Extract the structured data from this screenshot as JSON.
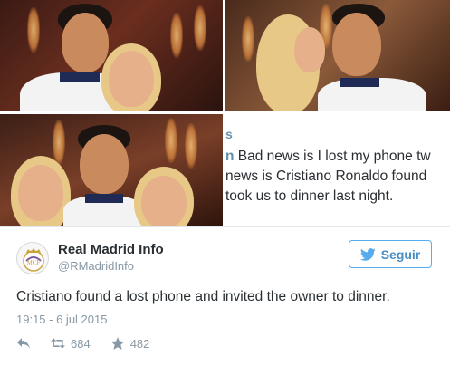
{
  "collage": {
    "snippet": {
      "top_fragment": "s",
      "lines": [
        {
          "lead": "n",
          "text": " Bad news is I lost my phone tw"
        },
        {
          "lead": "",
          "text": " news is Cristiano Ronaldo found"
        },
        {
          "lead": "",
          "text": " took us to dinner last night."
        }
      ]
    }
  },
  "tweet": {
    "author_name": "Real Madrid Info",
    "author_handle": "@RMadridInfo",
    "follow_label": "Seguir",
    "text": "Cristiano found a lost phone and invited the owner to dinner.",
    "timestamp": "19:15 - 6 jul 2015",
    "retweets": "684",
    "favorites": "482"
  },
  "icons": {
    "reply": "reply-icon",
    "retweet": "retweet-icon",
    "favorite": "star-icon",
    "follow": "bird-icon"
  },
  "colors": {
    "accent": "#55acee",
    "muted": "#8899a6",
    "text": "#292f33"
  }
}
